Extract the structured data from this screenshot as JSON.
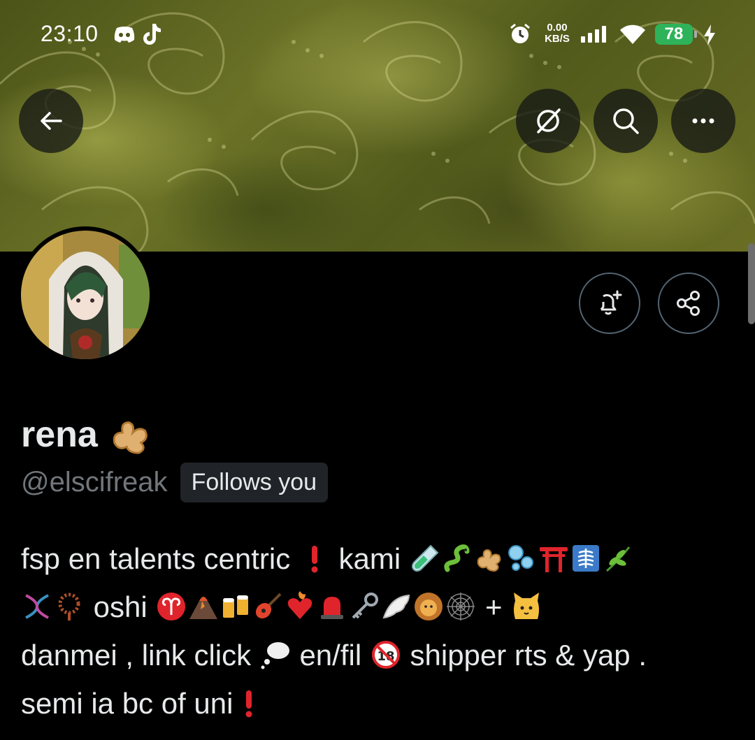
{
  "status_bar": {
    "time": "23:10",
    "notification_icons": [
      "discord-icon",
      "tiktok-icon"
    ],
    "net_speed_value": "0.00",
    "net_speed_unit": "KB/S",
    "battery_percent": "78",
    "system_icons": [
      "alarm-icon",
      "signal-icon",
      "wifi-icon",
      "charging-icon"
    ]
  },
  "header": {
    "back_icon": "arrow-left-icon",
    "action_icons": [
      "grok-icon",
      "search-icon",
      "more-icon"
    ]
  },
  "profile": {
    "display_name": "rena",
    "name_emoji": "ginger-root",
    "handle": "@elscifreak",
    "follows_you_label": "Follows you",
    "bio": {
      "seg1": "fsp en talents centric ",
      "seg2": " kami ",
      "seg3": " oshi ",
      "seg4": " + ",
      "seg5": "danmei , link click ",
      "seg6": " en/fil ",
      "seg7": " shipper rts & yap .",
      "seg8": "semi ia bc of uni"
    },
    "actions": [
      "notification-bell-add-icon",
      "share-icon"
    ]
  },
  "colors": {
    "background": "#000000",
    "text_primary": "#e7e9ea",
    "text_secondary": "#71767b",
    "badge_bg": "#202327",
    "battery_green": "#2eb35a",
    "banner_olive": "#5e6620"
  }
}
